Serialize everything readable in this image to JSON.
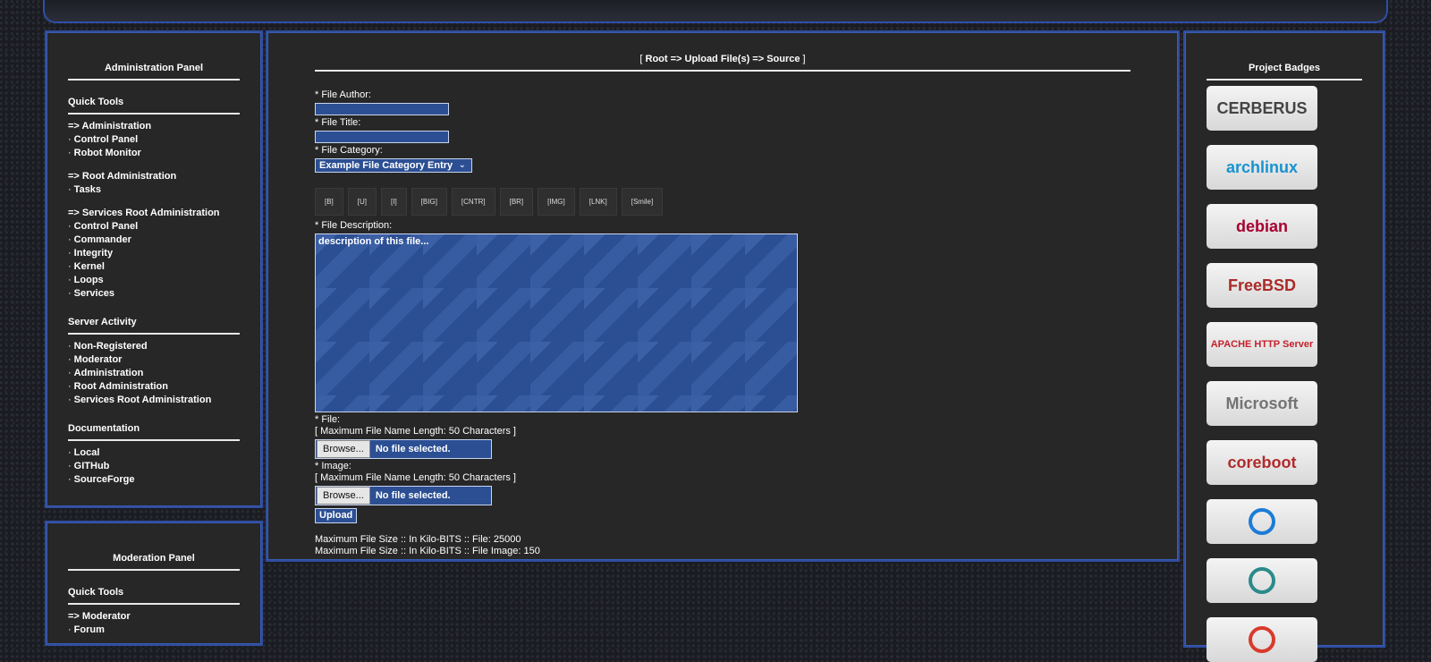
{
  "admin_panel": {
    "title": "Administration Panel",
    "sections": [
      {
        "title": "Quick Tools",
        "items": [
          {
            "text": "=> Administration",
            "arrow": true
          },
          {
            "text": "Control Panel"
          },
          {
            "text": "Robot Monitor"
          },
          {
            "text": "=> Root Administration",
            "arrow": true,
            "gap": true
          },
          {
            "text": "Tasks"
          },
          {
            "text": "=> Services Root Administration",
            "arrow": true,
            "gap": true
          },
          {
            "text": "Control Panel"
          },
          {
            "text": "Commander"
          },
          {
            "text": "Integrity"
          },
          {
            "text": "Kernel"
          },
          {
            "text": "Loops"
          },
          {
            "text": "Services"
          }
        ]
      },
      {
        "title": "Server Activity",
        "items": [
          {
            "text": "Non-Registered"
          },
          {
            "text": "Moderator"
          },
          {
            "text": "Administration"
          },
          {
            "text": "Root Administration"
          },
          {
            "text": "Services Root Administration"
          }
        ]
      },
      {
        "title": "Documentation",
        "items": [
          {
            "text": "Local"
          },
          {
            "text": "GITHub"
          },
          {
            "text": "SourceForge"
          }
        ]
      }
    ]
  },
  "mod_panel": {
    "title": "Moderation Panel",
    "section_title": "Quick Tools",
    "items": [
      {
        "text": "=> Moderator",
        "arrow": true
      },
      {
        "text": "Forum"
      }
    ]
  },
  "bullet": "·",
  "main": {
    "crumb_open": "[ ",
    "crumb_path": "Root => Upload File(s) => Source",
    "crumb_close": " ]",
    "author_label": "* File Author:",
    "title_label": "* File Title:",
    "category_label": "* File Category:",
    "category_value": "Example File Category Entry",
    "toolbar": [
      "[B]",
      "[U]",
      "[I]",
      "[BIG]",
      "[CNTR]",
      "[BR]",
      "[IMG]",
      "[LNK]",
      "[Smile]"
    ],
    "description_label": "* File Description:",
    "description_value": "description of this file...",
    "file_label": "* File:",
    "file_limit": "[ Maximum File Name Length: 50 Characters ]",
    "image_label": "* Image:",
    "image_limit": "[ Maximum File Name Length: 50 Characters ]",
    "browse_label": "Browse...",
    "no_file": "No file selected.",
    "upload_label": "Upload",
    "max_file": "Maximum File Size :: In Kilo-BITS :: File: 25000",
    "max_image": "Maximum File Size :: In Kilo-BITS :: File Image: 150"
  },
  "badges": {
    "title": "Project Badges",
    "items": [
      {
        "name": "CERBERUS",
        "color": "#444444"
      },
      {
        "name": "archlinux",
        "color": "#1793d1"
      },
      {
        "name": "debian",
        "color": "#a80030"
      },
      {
        "name": "FreeBSD",
        "color": "#ab2b28"
      },
      {
        "name": "APACHE HTTP Server",
        "color": "#c6212c"
      },
      {
        "name": "Microsoft",
        "color": "#737373"
      },
      {
        "name": "coreboot",
        "color": "#b22a2a"
      },
      {
        "name": "",
        "color": "#1c7cd6"
      },
      {
        "name": "",
        "color": "#2b8a8a"
      },
      {
        "name": "",
        "color": "#d93a2b"
      }
    ]
  }
}
